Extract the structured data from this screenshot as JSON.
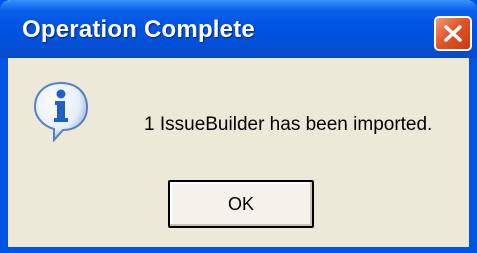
{
  "dialog": {
    "title": "Operation Complete",
    "message": "1 IssueBuilder has been imported.",
    "ok_label": "OK",
    "icon": "information-icon",
    "close_icon": "close-icon"
  },
  "colors": {
    "titlebar": "#0054e3",
    "body": "#ece9d8",
    "close_button": "#e2552b",
    "info_icon": "#2a6fd0"
  }
}
